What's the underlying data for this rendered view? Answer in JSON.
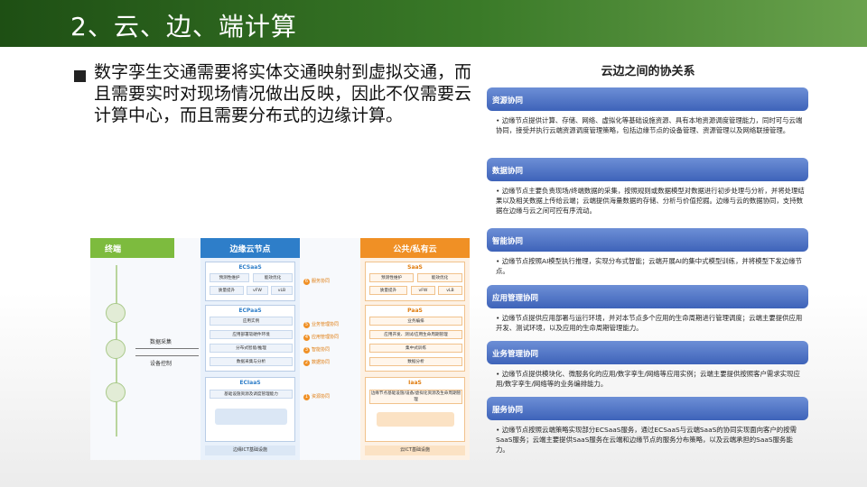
{
  "slide": {
    "title": "2、云、边、端计算",
    "body": "数字孪生交通需要将实体交通映射到虚拟交通，而且需要实时对现场情况做出反映，因此不仅需要云计算中心，而且需要分布式的边缘计算。"
  },
  "relation": {
    "title": "云边之间的协关系",
    "sections": [
      {
        "label": "资源协同",
        "text": "• 边缘节点提供计算、存储、网络、虚拟化等基础设施资源、具有本地资源调度管理能力，同时可与云端协同，接受并执行云端资源调度管理策略，包括边缘节点的设备管理、资源管理以及网络联接管理。"
      },
      {
        "label": "数据协同",
        "text": "• 边缘节点主要负责现场/终端数据的采集，按照规则或数据模型对数据进行初步处理与分析，并将处理结果以及相关数据上传给云端；云端提供海量数据的存储、分析与价值挖掘。边缘与云的数据协同，支持数据在边缘与云之间可控有序流动。"
      },
      {
        "label": "智能协同",
        "text": "• 边缘节点按照AI模型执行推理，实现分布式智能；云端开展AI的集中式模型训练，并将模型下发边缘节点。"
      },
      {
        "label": "应用管理协同",
        "text": "• 边缘节点提供应用部署与运行环境，并对本节点多个应用的生命周期进行管理调度；云端主要提供应用开发、测试环境，以及应用的生命周期管理能力。"
      },
      {
        "label": "业务管理协同",
        "text": "• 边缘节点提供模块化、微服务化的应用/数字孪生/网络等应用实例；云端主要提供按照客户需求实现应用/数字孪生/网络等的业务编排能力。"
      },
      {
        "label": "服务协同",
        "text": "• 边缘节点按照云端策略实现部分ECSaaS服务，通过ECSaaS与云端SaaS的协同实现面向客户的按需SaaS服务；云端主要提供SaaS服务在云端和边缘节点的服务分布策略，以及云端承担的SaaS服务能力。"
      }
    ]
  },
  "diagram": {
    "terminal_label": "终端",
    "edge_label": "边缘云节点",
    "cloud_label": "公共/私有云",
    "arrow_up": "数据采集",
    "arrow_down": "设备控制",
    "edge_boxes": [
      {
        "title": "ECSaaS",
        "chips": [
          "预测性维护",
          "能效优化",
          "质量提升",
          "vFW",
          "vLB"
        ]
      },
      {
        "title": "ECPaaS",
        "chips": [
          "应用实例",
          "应用部署软硬件环境",
          "分布式智能/推理",
          "数据采集与分析"
        ]
      },
      {
        "title": "ECIaaS",
        "chips": [
          "基础设施资源及调度管理能力"
        ]
      }
    ],
    "edge_footer": "边缘ICT基础设施",
    "cloud_boxes": [
      {
        "title": "SaaS",
        "chips": [
          "预测性维护",
          "能效优化",
          "质量提升",
          "vFW",
          "vLB"
        ]
      },
      {
        "title": "PaaS",
        "chips": [
          "业务编排",
          "应用开发、测试/应用生命周期管理",
          "集中式训练",
          "数据分析"
        ]
      },
      {
        "title": "IaaS",
        "chips": [
          "边缘节点基础设施/设备/虚拟化资源及生命周期管理"
        ]
      }
    ],
    "cloud_footer": "云ICT基础设施",
    "collabs": [
      {
        "num": "6",
        "label": "服务协同"
      },
      {
        "num": "5",
        "label": "业务管理协同"
      },
      {
        "num": "4",
        "label": "应用管理协同"
      },
      {
        "num": "3",
        "label": "智能协同"
      },
      {
        "num": "2",
        "label": "数据协同"
      },
      {
        "num": "1",
        "label": "资源协同"
      }
    ]
  }
}
